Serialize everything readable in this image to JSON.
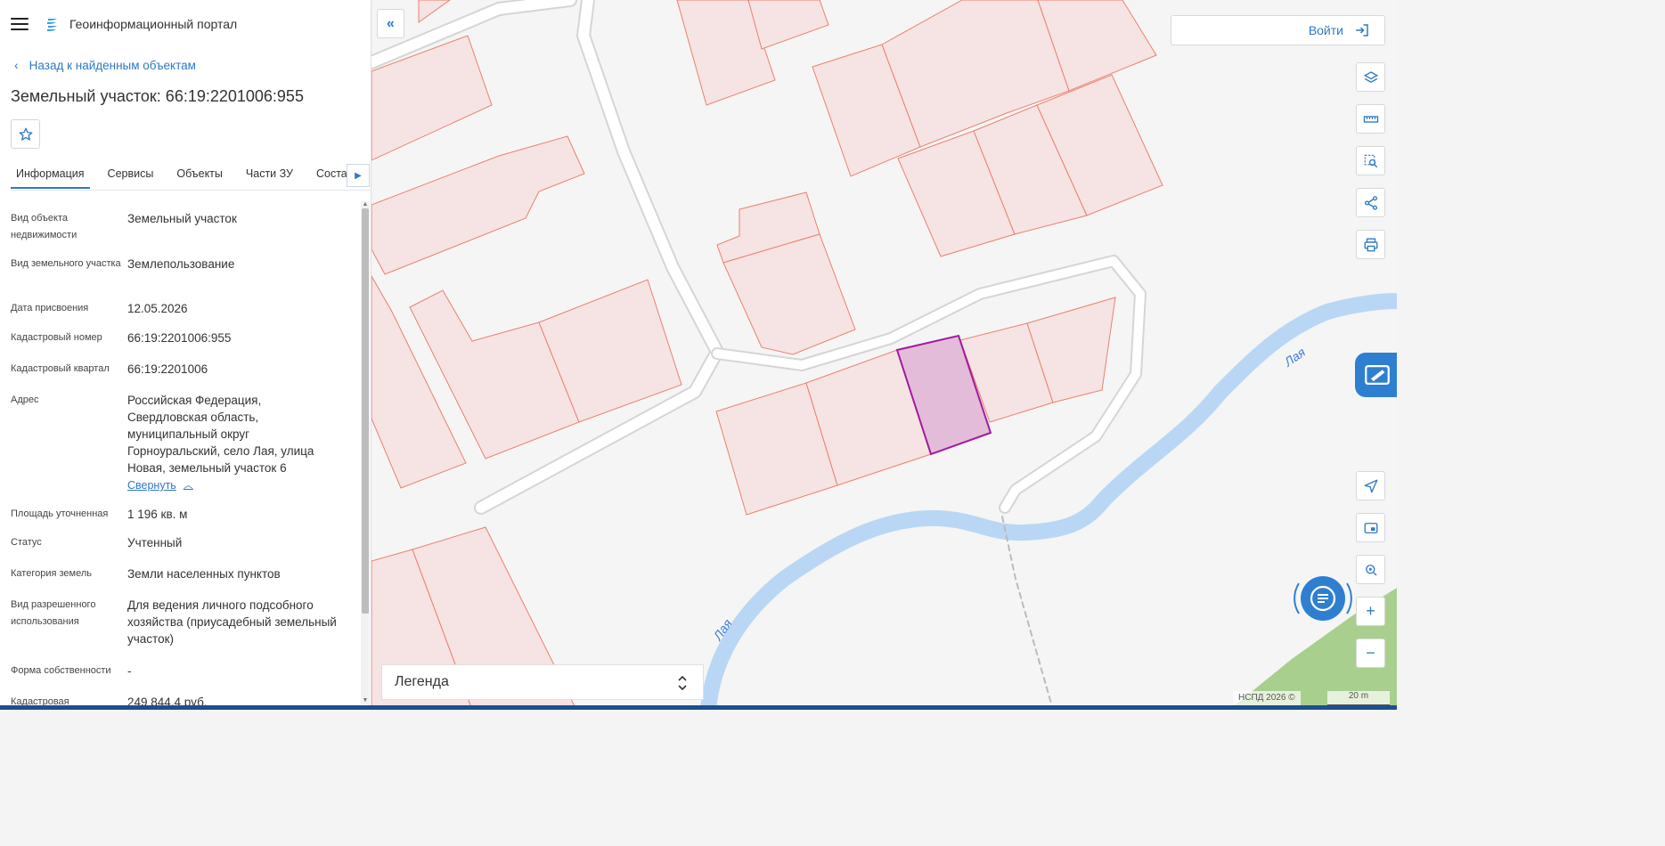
{
  "app": {
    "portal_title": "Геоинформационный портал"
  },
  "nav": {
    "back_label": "Назад к найденным объектам"
  },
  "object": {
    "title": "Земельный участок: 66:19:2201006:955"
  },
  "tabs": [
    {
      "label": "Информация",
      "active": true
    },
    {
      "label": "Сервисы"
    },
    {
      "label": "Объекты"
    },
    {
      "label": "Части ЗУ"
    },
    {
      "label": "Состав"
    }
  ],
  "details": {
    "rows": [
      {
        "key": "Вид объекта недвижимости",
        "value": "Земельный участок"
      },
      {
        "key": "Вид земельного участка",
        "value": "Землепользование"
      },
      {
        "key": "Дата присвоения",
        "value": "12.05.2026"
      },
      {
        "key": "Кадастровый номер",
        "value": "66:19:2201006:955"
      },
      {
        "key": "Кадастровый квартал",
        "value": "66:19:2201006"
      },
      {
        "key": "Адрес",
        "value": "Российская Федерация, Свердловская область, муниципальный округ Горноуральский, село Лая, улица Новая, земельный участок 6"
      },
      {
        "key": "Площадь уточненная",
        "value": "1 196 кв. м"
      },
      {
        "key": "Статус",
        "value": "Учтенный"
      },
      {
        "key": "Категория земель",
        "value": "Земли населенных пунктов"
      },
      {
        "key": "Вид разрешенного использования",
        "value": "Для ведения личного подсобного хозяйства (приусадебный земельный участок)"
      },
      {
        "key": "Форма собственности",
        "value": "-"
      },
      {
        "key": "Кадастровая",
        "value": "249 844,4 руб."
      }
    ],
    "collapse_label": "Свернуть"
  },
  "map": {
    "login_label": "Войти",
    "legend_label": "Легенда",
    "attribution": "НСПД 2026 ©",
    "scale_label": "20 m",
    "river_label": "Лая",
    "colors": {
      "parcel_fill": "#f6e3e3",
      "parcel_stroke": "#e8826f",
      "selected_fill": "#e3bcd9",
      "selected_stroke": "#a21aa0",
      "river": "#b9d7f5",
      "road": "#ffffff",
      "road_edge": "#d5d5d5",
      "green": "#a9cf8e",
      "accent": "#2f78c6"
    }
  }
}
